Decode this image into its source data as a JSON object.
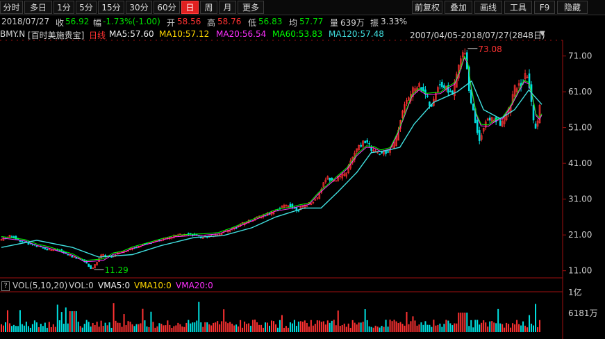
{
  "toolbar": {
    "left": [
      {
        "label": "分时",
        "active": false
      },
      {
        "label": "多日",
        "active": false
      },
      {
        "label": "1分",
        "active": false
      },
      {
        "label": "5分",
        "active": false
      },
      {
        "label": "15分",
        "active": false
      },
      {
        "label": "30分",
        "active": false
      },
      {
        "label": "60分",
        "active": false
      },
      {
        "label": "日",
        "active": true
      },
      {
        "label": "周",
        "active": false
      },
      {
        "label": "月",
        "active": false
      },
      {
        "label": "更多",
        "active": false
      }
    ],
    "right": [
      {
        "label": "前复权"
      },
      {
        "label": "叠加"
      },
      {
        "label": "画线"
      },
      {
        "label": "工具"
      },
      {
        "label": "F9"
      },
      {
        "label": "隐藏"
      }
    ]
  },
  "info": {
    "date": "2018/07/27",
    "close_label": "收",
    "close": "56.92",
    "change_label": "幅",
    "change": "-1.73%(-1.00)",
    "open_label": "开",
    "open": "58.56",
    "high_label": "高",
    "high": "58.76",
    "low_label": "低",
    "low": "56.83",
    "avg_label": "均",
    "avg": "57.77",
    "volume_label": "量",
    "volume": "639万",
    "amplitude_label": "振",
    "amplitude": "3.33%"
  },
  "ma": {
    "symbol": "BMY.N",
    "name": "[百时美施贵宝]",
    "period": "日线",
    "ma5": "MA5:57.60",
    "ma10": "MA10:57.12",
    "ma20": "MA20:56.54",
    "ma60": "MA60:53.83",
    "ma120": "MA120:57.48",
    "range": "2007/04/05-2018/07/27(2848日)"
  },
  "vol": {
    "label": "VOL(5,10,20)",
    "vol": "VOL:0",
    "vma5": "VMA5:0",
    "vma10": "VMA10:0",
    "vma20": "VMA20:0"
  },
  "colors": {
    "up": "#ff3232",
    "down": "#00e0e0",
    "ma5": "#f0f0f0",
    "ma10": "#ffd700",
    "ma20": "#ff30ff",
    "ma60": "#00ff00",
    "ma120": "#40e0e0",
    "axis": "#a01010"
  },
  "chart_data": {
    "type": "line",
    "title": "BMY.N [百时美施贵宝] 日线",
    "y_ticks": [
      11,
      21,
      31,
      41,
      51,
      61,
      71
    ],
    "y_tick_labels": [
      "11.00",
      "21.00",
      "31.00",
      "41.00",
      "51.00",
      "61.00",
      "71.00"
    ],
    "ylim": [
      9,
      75
    ],
    "max_label": "73.08",
    "min_label": "11.29",
    "price_series": [
      {
        "x": 2007.26,
        "y": 19.5
      },
      {
        "x": 2007.5,
        "y": 20.8
      },
      {
        "x": 2007.75,
        "y": 19.0
      },
      {
        "x": 2008.0,
        "y": 18.2
      },
      {
        "x": 2008.25,
        "y": 17.0
      },
      {
        "x": 2008.5,
        "y": 16.8
      },
      {
        "x": 2008.75,
        "y": 15.0
      },
      {
        "x": 2009.0,
        "y": 14.2
      },
      {
        "x": 2009.2,
        "y": 11.3
      },
      {
        "x": 2009.4,
        "y": 15.5
      },
      {
        "x": 2009.6,
        "y": 15.0
      },
      {
        "x": 2009.8,
        "y": 16.2
      },
      {
        "x": 2010.0,
        "y": 17.0
      },
      {
        "x": 2010.3,
        "y": 18.5
      },
      {
        "x": 2010.6,
        "y": 19.5
      },
      {
        "x": 2010.9,
        "y": 20.5
      },
      {
        "x": 2011.2,
        "y": 21.5
      },
      {
        "x": 2011.5,
        "y": 20.3
      },
      {
        "x": 2011.8,
        "y": 21.0
      },
      {
        "x": 2012.1,
        "y": 22.5
      },
      {
        "x": 2012.4,
        "y": 24.5
      },
      {
        "x": 2012.7,
        "y": 26.0
      },
      {
        "x": 2013.0,
        "y": 27.5
      },
      {
        "x": 2013.3,
        "y": 29.5
      },
      {
        "x": 2013.5,
        "y": 28.0
      },
      {
        "x": 2013.7,
        "y": 29.5
      },
      {
        "x": 2013.9,
        "y": 31.0
      },
      {
        "x": 2014.1,
        "y": 37.0
      },
      {
        "x": 2014.3,
        "y": 36.5
      },
      {
        "x": 2014.5,
        "y": 38.0
      },
      {
        "x": 2014.7,
        "y": 44.0
      },
      {
        "x": 2014.9,
        "y": 47.5
      },
      {
        "x": 2015.05,
        "y": 45.0
      },
      {
        "x": 2015.2,
        "y": 43.5
      },
      {
        "x": 2015.4,
        "y": 44.5
      },
      {
        "x": 2015.55,
        "y": 47.0
      },
      {
        "x": 2015.7,
        "y": 56.0
      },
      {
        "x": 2015.85,
        "y": 60.0
      },
      {
        "x": 2016.0,
        "y": 63.0
      },
      {
        "x": 2016.15,
        "y": 61.5
      },
      {
        "x": 2016.3,
        "y": 56.0
      },
      {
        "x": 2016.45,
        "y": 63.5
      },
      {
        "x": 2016.6,
        "y": 62.0
      },
      {
        "x": 2016.75,
        "y": 60.5
      },
      {
        "x": 2016.85,
        "y": 67.0
      },
      {
        "x": 2016.95,
        "y": 71.5
      },
      {
        "x": 2017.02,
        "y": 73.1
      },
      {
        "x": 2017.08,
        "y": 62.0
      },
      {
        "x": 2017.2,
        "y": 54.0
      },
      {
        "x": 2017.3,
        "y": 47.5
      },
      {
        "x": 2017.45,
        "y": 53.0
      },
      {
        "x": 2017.6,
        "y": 53.5
      },
      {
        "x": 2017.75,
        "y": 52.0
      },
      {
        "x": 2017.9,
        "y": 55.0
      },
      {
        "x": 2018.05,
        "y": 62.0
      },
      {
        "x": 2018.2,
        "y": 63.0
      },
      {
        "x": 2018.3,
        "y": 66.5
      },
      {
        "x": 2018.38,
        "y": 60.0
      },
      {
        "x": 2018.45,
        "y": 51.0
      },
      {
        "x": 2018.52,
        "y": 52.0
      },
      {
        "x": 2018.57,
        "y": 56.92
      }
    ],
    "ma120_series": [
      {
        "x": 2007.26,
        "y": 17.5
      },
      {
        "x": 2008.0,
        "y": 19.5
      },
      {
        "x": 2008.75,
        "y": 17.5
      },
      {
        "x": 2009.3,
        "y": 14.8
      },
      {
        "x": 2010.0,
        "y": 15.5
      },
      {
        "x": 2010.6,
        "y": 18.0
      },
      {
        "x": 2011.3,
        "y": 20.3
      },
      {
        "x": 2011.9,
        "y": 20.8
      },
      {
        "x": 2012.5,
        "y": 23.0
      },
      {
        "x": 2013.0,
        "y": 26.0
      },
      {
        "x": 2013.6,
        "y": 28.5
      },
      {
        "x": 2013.95,
        "y": 28.5
      },
      {
        "x": 2014.3,
        "y": 33.0
      },
      {
        "x": 2014.7,
        "y": 38.5
      },
      {
        "x": 2015.0,
        "y": 44.0
      },
      {
        "x": 2015.3,
        "y": 44.5
      },
      {
        "x": 2015.6,
        "y": 45.5
      },
      {
        "x": 2015.9,
        "y": 52.0
      },
      {
        "x": 2016.3,
        "y": 58.0
      },
      {
        "x": 2016.8,
        "y": 61.0
      },
      {
        "x": 2017.1,
        "y": 64.0
      },
      {
        "x": 2017.35,
        "y": 56.0
      },
      {
        "x": 2017.7,
        "y": 53.5
      },
      {
        "x": 2018.0,
        "y": 56.0
      },
      {
        "x": 2018.3,
        "y": 61.5
      },
      {
        "x": 2018.57,
        "y": 57.48
      }
    ],
    "volume_ticks": [
      "1亿",
      "6181万"
    ]
  }
}
